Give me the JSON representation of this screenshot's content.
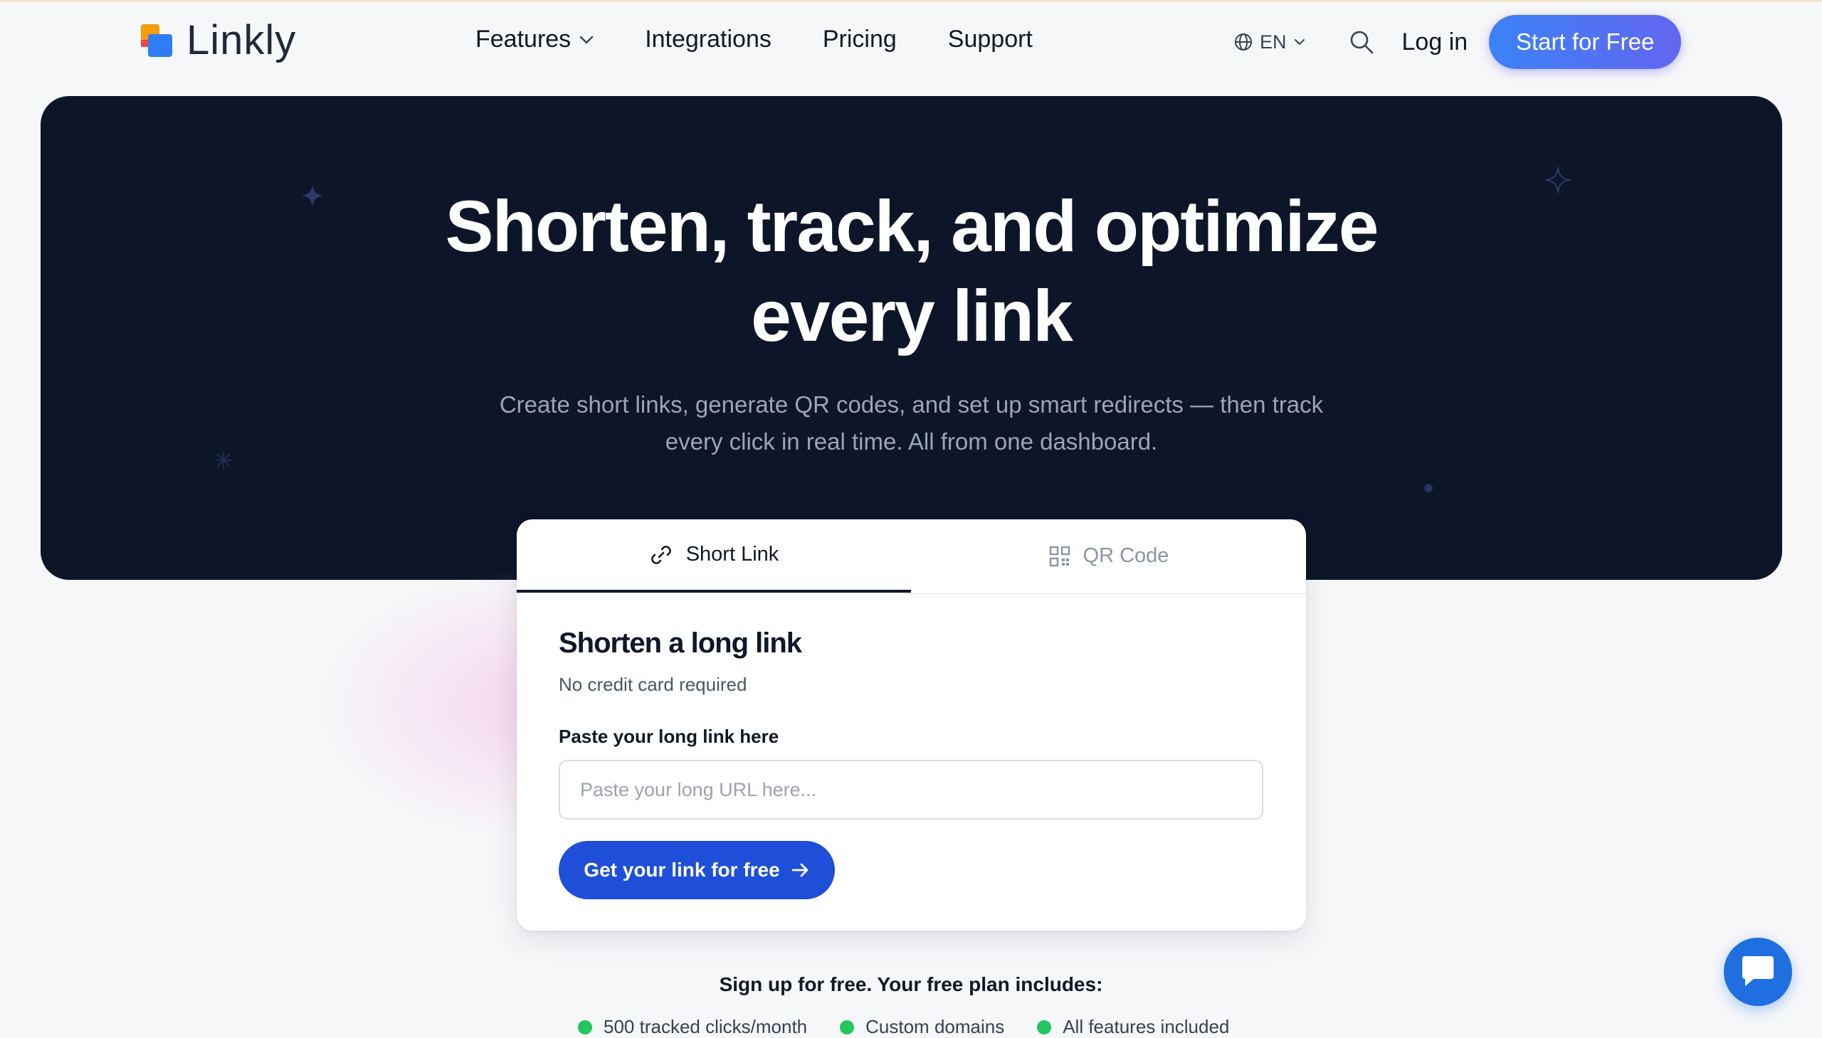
{
  "brand": {
    "name": "Linkly"
  },
  "nav": {
    "items": [
      {
        "label": "Features",
        "has_dropdown": true
      },
      {
        "label": "Integrations"
      },
      {
        "label": "Pricing"
      },
      {
        "label": "Support"
      }
    ],
    "language": "EN",
    "login_label": "Log in",
    "cta_label": "Start for Free"
  },
  "hero": {
    "title_line1": "Shorten, track, and optimize",
    "title_line2": "every link",
    "subtitle_line1": "Create short links, generate QR codes, and set up smart redirects — then track",
    "subtitle_line2": "every click in real time. All from one dashboard."
  },
  "card": {
    "tabs": [
      {
        "label": "Short Link",
        "active": true
      },
      {
        "label": "QR Code",
        "active": false
      }
    ],
    "heading": "Shorten a long link",
    "subheading": "No credit card required",
    "input_label": "Paste your long link here",
    "input_placeholder": "Paste your long URL here...",
    "input_value": "",
    "button_label": "Get your link for free"
  },
  "signup": {
    "text": "Sign up for free. Your free plan includes:",
    "features": [
      "500 tracked clicks/month",
      "Custom domains",
      "All features included"
    ]
  },
  "colors": {
    "accent": "#1f4fd8",
    "hero_bg": "#0c1628",
    "feature_dot": "#22c55e"
  }
}
